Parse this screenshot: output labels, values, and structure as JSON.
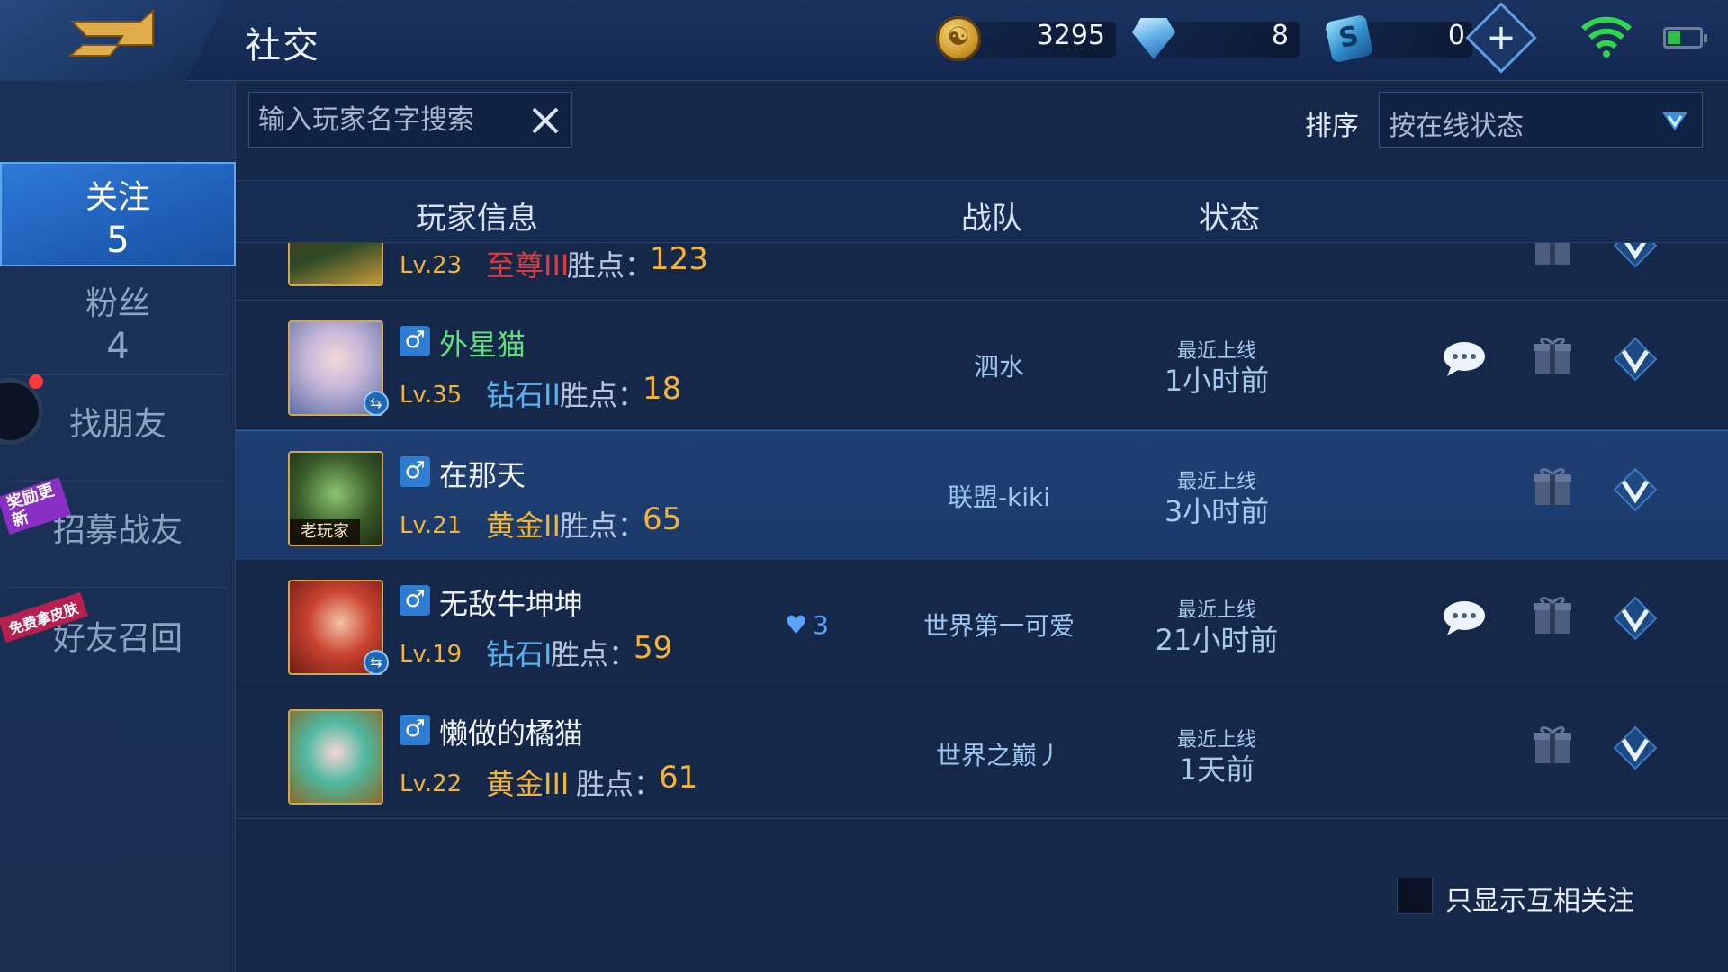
{
  "header": {
    "title": "社交",
    "coins": "3295",
    "diamonds": "8",
    "vouchers": "0",
    "icons": [
      "back-icon",
      "coin-icon",
      "diamond-icon",
      "voucher-icon",
      "plus-icon",
      "wifi-icon",
      "battery-icon"
    ]
  },
  "sidebar": {
    "items": [
      {
        "label": "关注",
        "count": "5"
      },
      {
        "label": "粉丝",
        "count": "4"
      },
      {
        "label": "找朋友"
      },
      {
        "label": "招募战友",
        "ribbon": "奖励更新"
      },
      {
        "label": "好友召回",
        "ribbon": "免费拿皮肤"
      }
    ]
  },
  "search": {
    "placeholder": "输入玩家名字搜索"
  },
  "sort": {
    "label": "排序",
    "value": "按在线状态"
  },
  "table": {
    "headers": {
      "player": "玩家信息",
      "team": "战队",
      "status": "状态"
    },
    "partial_row": {
      "level": "Lv.23",
      "rank": "至尊III",
      "points_label": "胜点：",
      "points": "123"
    },
    "rows": [
      {
        "name": "外星猫",
        "level": "Lv.35",
        "rank": "钻石II",
        "points_label": "胜点：",
        "points": "18",
        "team": "泗水",
        "status_label": "最近上线",
        "status_value": "1小时前"
      },
      {
        "name": "在那天",
        "level": "Lv.21",
        "rank": "黄金II",
        "points_label": "胜点：",
        "points": "65",
        "team": "联盟-kiki",
        "status_label": "最近上线",
        "status_value": "3小时前",
        "tag": "老玩家"
      },
      {
        "name": "无敌牛坤坤",
        "level": "Lv.19",
        "rank": "钻石I",
        "points_label": "胜点：",
        "points": "59",
        "team": "世界第一可爱",
        "status_label": "最近上线",
        "status_value": "21小时前",
        "intimacy": "3"
      },
      {
        "name": "懒做的橘猫",
        "level": "Lv.22",
        "rank": "黄金III",
        "points_label": "胜点：",
        "points": "61",
        "team": "世界之巅丿",
        "status_label": "最近上线",
        "status_value": "1天前"
      }
    ]
  },
  "footer": {
    "mutual_only_label": "只显示互相关注"
  },
  "colors": {
    "gold": "#f2b436",
    "diamond_rank": "#58b2f0",
    "supreme_rank": "#e23a3a",
    "online_green": "#5fe07a",
    "accent_blue": "#2f7ad6"
  }
}
